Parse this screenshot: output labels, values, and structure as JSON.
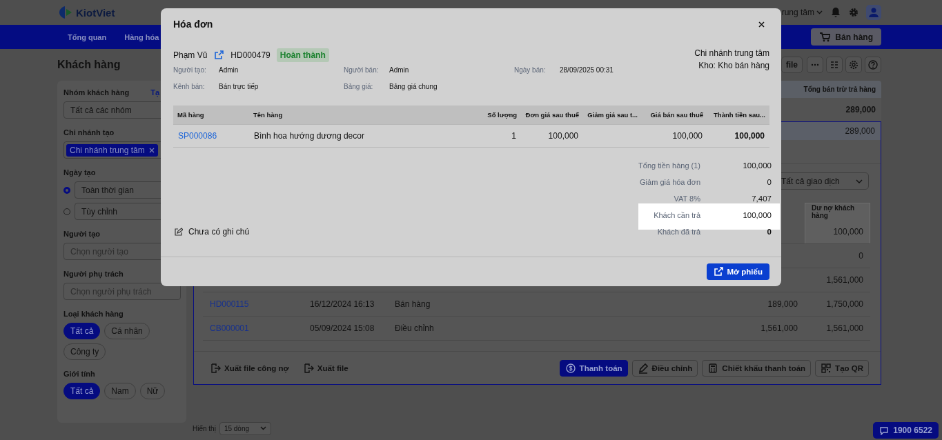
{
  "header": {
    "logo": "KiotViet",
    "branch": "rung tâm"
  },
  "nav": {
    "items": [
      {
        "label": "Tổng quan",
        "selected": false
      },
      {
        "label": "Hàng hóa",
        "selected": false
      }
    ],
    "sell_button": "Bán hàng"
  },
  "page_title": "Khách hàng",
  "toolbar": {
    "file_button": "file"
  },
  "filters": [
    {
      "kind": "select",
      "label": "Nhóm khách hàng",
      "link": "Tạ",
      "value": "Tất cả các nhóm"
    },
    {
      "kind": "tags",
      "label": "Chi nhánh tạo",
      "tags": [
        "Chi nhánh trung tâm"
      ]
    },
    {
      "kind": "radios",
      "label": "Ngày tạo",
      "options": [
        {
          "label": "Toàn thời gian",
          "selected": true
        },
        {
          "label": "Tùy chỉnh",
          "selected": false
        }
      ]
    },
    {
      "kind": "input",
      "label": "Người tạo",
      "placeholder": "Chọn người tạo"
    },
    {
      "kind": "input",
      "label": "Người phụ trách",
      "placeholder": "Chọn người phụ trách"
    },
    {
      "kind": "chips",
      "label": "Loại khách hàng",
      "options": [
        {
          "label": "Tất cả",
          "selected": true
        },
        {
          "label": "Cá nhân",
          "selected": false
        },
        {
          "label": "Công ty",
          "selected": false
        }
      ]
    },
    {
      "kind": "chips",
      "label": "Giới tính",
      "options": [
        {
          "label": "Tất cả",
          "selected": true
        },
        {
          "label": "Nam",
          "selected": false
        },
        {
          "label": "Nữ",
          "selected": false
        }
      ]
    }
  ],
  "customer_table": {
    "column": "Tổng bán trừ trả hàng",
    "total": "289,000",
    "row_value": "289,000"
  },
  "detail": {
    "filter": "Tất cả giao dịch",
    "column": "Dư nợ khách hàng",
    "column_highlighted": true,
    "rows": [
      {
        "balance": "100,000",
        "highlighted": true
      },
      {
        "balance": "0",
        "highlighted": false
      },
      {
        "balance": "1,561,000",
        "highlighted": false
      },
      {
        "code": "HD000115",
        "date": "16/12/2024 16:13",
        "type": "Bán hàng",
        "value": "189,000",
        "balance": "1,750,000",
        "highlighted": false
      },
      {
        "code": "CB000001",
        "date": "05/09/2024 15:08",
        "type": "Điều chỉnh",
        "value": "1,561,000",
        "balance": "1,561,000",
        "highlighted": false
      }
    ],
    "actions": [
      {
        "kind": "link",
        "label": "Xuất file công nợ"
      },
      {
        "kind": "link",
        "label": "Xuất file"
      },
      {
        "kind": "primary",
        "label": "Thanh toán"
      },
      {
        "kind": "outline",
        "label": "Điều chỉnh"
      },
      {
        "kind": "outline",
        "label": "Chiết khấu thanh toán"
      },
      {
        "kind": "outline",
        "label": "Tạo QR"
      }
    ]
  },
  "footer": {
    "label": "Hiển thị",
    "page_size": "15 dòng"
  },
  "hotline": "1900 6522",
  "modal": {
    "title": "Hóa đơn",
    "customer": "Phạm Vũ",
    "code": "HD000479",
    "status": "Hoàn thành",
    "branch": "Chi nhánh trung tâm",
    "warehouse": "Kho: Kho bán hàng",
    "meta": [
      {
        "label": "Người tạo:",
        "value": "Admin"
      },
      {
        "label": "Người bán:",
        "value": "Admin"
      },
      {
        "label": "Ngày bán:",
        "value": "28/09/2025 00:31"
      },
      {
        "label": "Kênh bán:",
        "value": "Bán trực tiếp"
      },
      {
        "label": "Bảng giá:",
        "value": "Bảng giá chung"
      }
    ],
    "columns": [
      "Mã hàng",
      "Tên hàng",
      "Số lượng",
      "Đơn giá sau thuế",
      "Giảm giá sau t...",
      "Giá bán sau thuế",
      "Thành tiền sau..."
    ],
    "items": [
      {
        "code": "SP000086",
        "name": "Bình hoa hướng dương decor",
        "qty": "1",
        "unit_price": "100,000",
        "price": "100,000",
        "total": "100,000"
      }
    ],
    "summary": [
      {
        "label": "Tổng tiền hàng (1)",
        "value": "100,000",
        "highlighted": false,
        "bold": false
      },
      {
        "label": "Giảm giá hóa đơn",
        "value": "0",
        "highlighted": false,
        "bold": false
      },
      {
        "label": "VAT 8%",
        "value": "7,407",
        "highlighted": false,
        "bold": false
      },
      {
        "label": "Khách cần trả",
        "value": "100,000",
        "highlighted": true,
        "bold": false
      },
      {
        "label": "Khách đã trả",
        "value": "0",
        "highlighted": false,
        "bold": true
      }
    ],
    "note": "Chưa có ghi chú",
    "open_button": "Mở phiếu"
  }
}
